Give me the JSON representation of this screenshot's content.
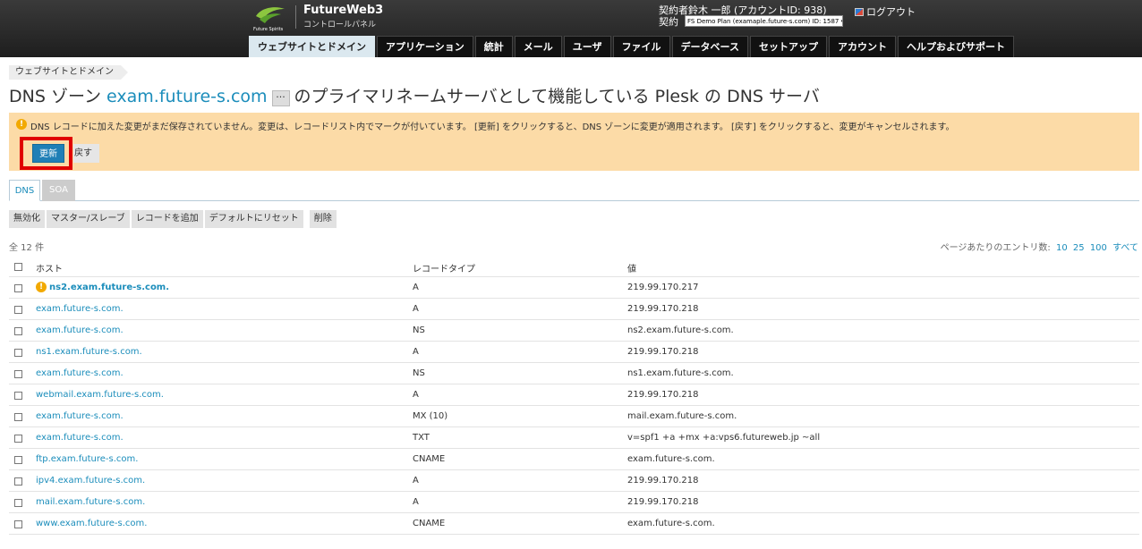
{
  "header": {
    "brand_name": "FutureWeb3",
    "brand_sub": "コントロールパネル",
    "logo_caption": "Future Spirits",
    "user_line": "契約者鈴木 一郎 (アカウントID: 938)",
    "subscription_label": "契約",
    "subscription_value": "FS Demo Plan (examaple.future-s.com) ID: 1587 ▾",
    "logout": "ログアウト"
  },
  "nav": {
    "tabs": [
      {
        "label": "ウェブサイトとドメイン"
      },
      {
        "label": "アプリケーション"
      },
      {
        "label": "統計"
      },
      {
        "label": "メール"
      },
      {
        "label": "ユーザ"
      },
      {
        "label": "ファイル"
      },
      {
        "label": "データベース"
      },
      {
        "label": "セットアップ"
      },
      {
        "label": "アカウント"
      },
      {
        "label": "ヘルプおよびサポート"
      }
    ]
  },
  "breadcrumb": "ウェブサイトとドメイン",
  "title": {
    "prefix": "DNS ゾーン",
    "domain": "exam.future-s.com",
    "more": "···",
    "suffix": "のプライマリネームサーバとして機能している Plesk の DNS サーバ"
  },
  "warning": {
    "text": "DNS レコードに加えた変更がまだ保存されていません。変更は、レコードリスト内でマークが付いています。 [更新] をクリックすると、DNS ゾーンに変更が適用されます。 [戻す] をクリックすると、変更がキャンセルされます。",
    "apply": "更新",
    "cancel": "戻す"
  },
  "tabs": {
    "dns": "DNS",
    "soa": "SOA"
  },
  "toolbar": {
    "disable": "無効化",
    "master_slave": "マスター/スレーブ",
    "add_record": "レコードを追加",
    "reset": "デフォルトにリセット",
    "delete": "削除"
  },
  "list": {
    "total": "全 12 件",
    "per_page_label": "ページあたりのエントリ数:",
    "per_page_options": [
      "10",
      "25",
      "100",
      "すべて"
    ]
  },
  "table": {
    "headers": {
      "host": "ホスト",
      "type": "レコードタイプ",
      "value": "値"
    },
    "rows": [
      {
        "host": "ns2.exam.future-s.com.",
        "type": "A",
        "value": "219.99.170.217"
      },
      {
        "host": "exam.future-s.com.",
        "type": "A",
        "value": "219.99.170.218"
      },
      {
        "host": "exam.future-s.com.",
        "type": "NS",
        "value": "ns2.exam.future-s.com."
      },
      {
        "host": "ns1.exam.future-s.com.",
        "type": "A",
        "value": "219.99.170.218"
      },
      {
        "host": "exam.future-s.com.",
        "type": "NS",
        "value": "ns1.exam.future-s.com."
      },
      {
        "host": "webmail.exam.future-s.com.",
        "type": "A",
        "value": "219.99.170.218"
      },
      {
        "host": "exam.future-s.com.",
        "type": "MX (10)",
        "value": "mail.exam.future-s.com."
      },
      {
        "host": "exam.future-s.com.",
        "type": "TXT",
        "value": "v=spf1 +a +mx +a:vps6.futureweb.jp ~all"
      },
      {
        "host": "ftp.exam.future-s.com.",
        "type": "CNAME",
        "value": "exam.future-s.com."
      },
      {
        "host": "ipv4.exam.future-s.com.",
        "type": "A",
        "value": "219.99.170.218"
      },
      {
        "host": "mail.exam.future-s.com.",
        "type": "A",
        "value": "219.99.170.218"
      },
      {
        "host": "www.exam.future-s.com.",
        "type": "CNAME",
        "value": "exam.future-s.com."
      }
    ]
  },
  "colors": {
    "accent": "#1b8dbb",
    "warning_bg": "#fcdba7",
    "highlight": "#e00000",
    "apply": "#1f7fb6"
  }
}
